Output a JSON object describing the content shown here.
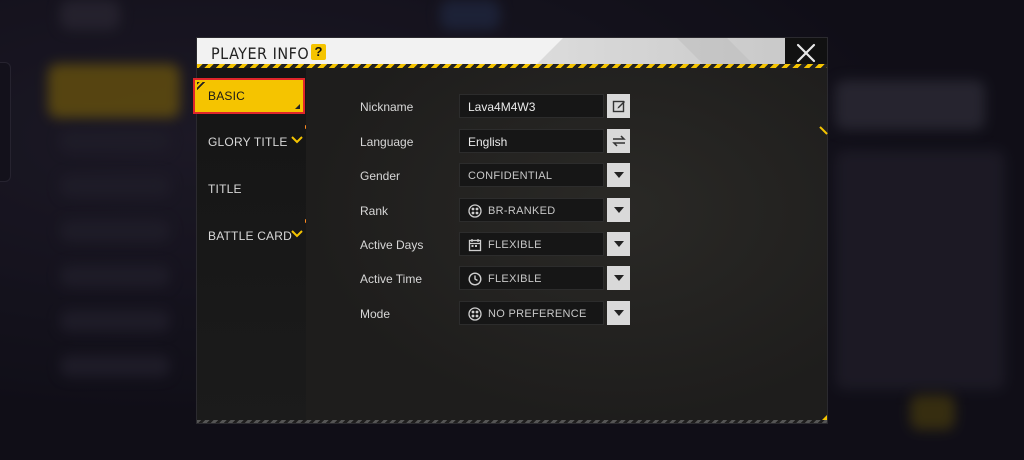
{
  "dialog": {
    "title": "PLAYER INFO",
    "help_label": "?"
  },
  "tabs": [
    {
      "label": "BASIC",
      "active": true
    },
    {
      "label": "GLORY TITLE",
      "has_dropdown": true,
      "has_dot": true
    },
    {
      "label": "TITLE"
    },
    {
      "label": "BATTLE CARD",
      "has_dropdown": true,
      "has_dot": true
    }
  ],
  "fields": {
    "nickname": {
      "label": "Nickname",
      "value": "Lava4M4W3",
      "button": "edit-icon"
    },
    "language": {
      "label": "Language",
      "value": "English",
      "button": "swap-icon"
    },
    "gender": {
      "label": "Gender",
      "value": "CONFIDENTIAL",
      "button": "dropdown-icon"
    },
    "rank": {
      "label": "Rank",
      "value": "BR-RANKED",
      "icon": "rank-icon",
      "button": "dropdown-icon"
    },
    "active_days": {
      "label": "Active Days",
      "value": "FLEXIBLE",
      "icon": "calendar-icon",
      "button": "dropdown-icon"
    },
    "active_time": {
      "label": "Active Time",
      "value": "FLEXIBLE",
      "icon": "clock-icon",
      "button": "dropdown-icon"
    },
    "mode": {
      "label": "Mode",
      "value": "NO PREFERENCE",
      "icon": "mode-icon",
      "button": "dropdown-icon"
    }
  },
  "colors": {
    "accent": "#f5c400",
    "highlight_border": "#e0262a",
    "notification_dot": "#ff8a1f"
  }
}
